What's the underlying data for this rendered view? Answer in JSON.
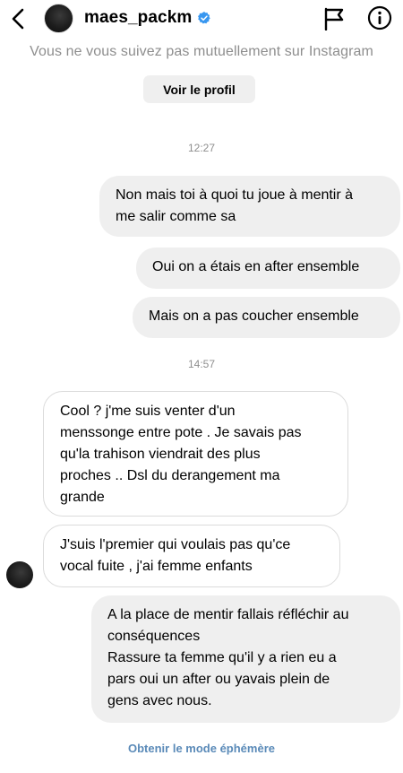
{
  "header": {
    "username": "maes_packm",
    "not_following_text": "Vous ne vous suivez pas mutuellement sur Instagram",
    "view_profile_label": "Voir le profil"
  },
  "colors": {
    "verified_badge": "#3897f0",
    "outgoing_bubble": "#efefef",
    "link": "#5a8ab8",
    "muted_text": "#8e8e8e"
  },
  "icons": {
    "back": "chevron-left-icon",
    "verified": "verified-badge-icon",
    "report": "flag-icon",
    "info": "info-icon"
  },
  "timestamps": [
    "12:27",
    "14:57"
  ],
  "messages": [
    {
      "direction": "outgoing",
      "text": "Non mais toi à quoi tu joue à mentir à\nme salir comme sa"
    },
    {
      "direction": "outgoing",
      "text": "Oui on a étais en after ensemble"
    },
    {
      "direction": "outgoing",
      "text": "Mais on a pas coucher ensemble"
    },
    {
      "direction": "incoming",
      "text": "Cool ? j'me suis venter d'un\nmenssonge entre pote . Je savais pas\nqu'la trahison viendrait des plus\nproches .. Dsl du derangement ma\ngrande"
    },
    {
      "direction": "incoming",
      "text": "J'suis l'premier qui voulais pas qu'ce\nvocal fuite , j'ai femme enfants"
    },
    {
      "direction": "outgoing",
      "text": "A la place de mentir fallais réfléchir au\nconséquences\nRassure ta femme qu'il y a rien eu a\npars oui un after ou yavais plein de\ngens avec nous."
    }
  ],
  "footer": {
    "ephemeral_label": "Obtenir le mode éphémère"
  }
}
